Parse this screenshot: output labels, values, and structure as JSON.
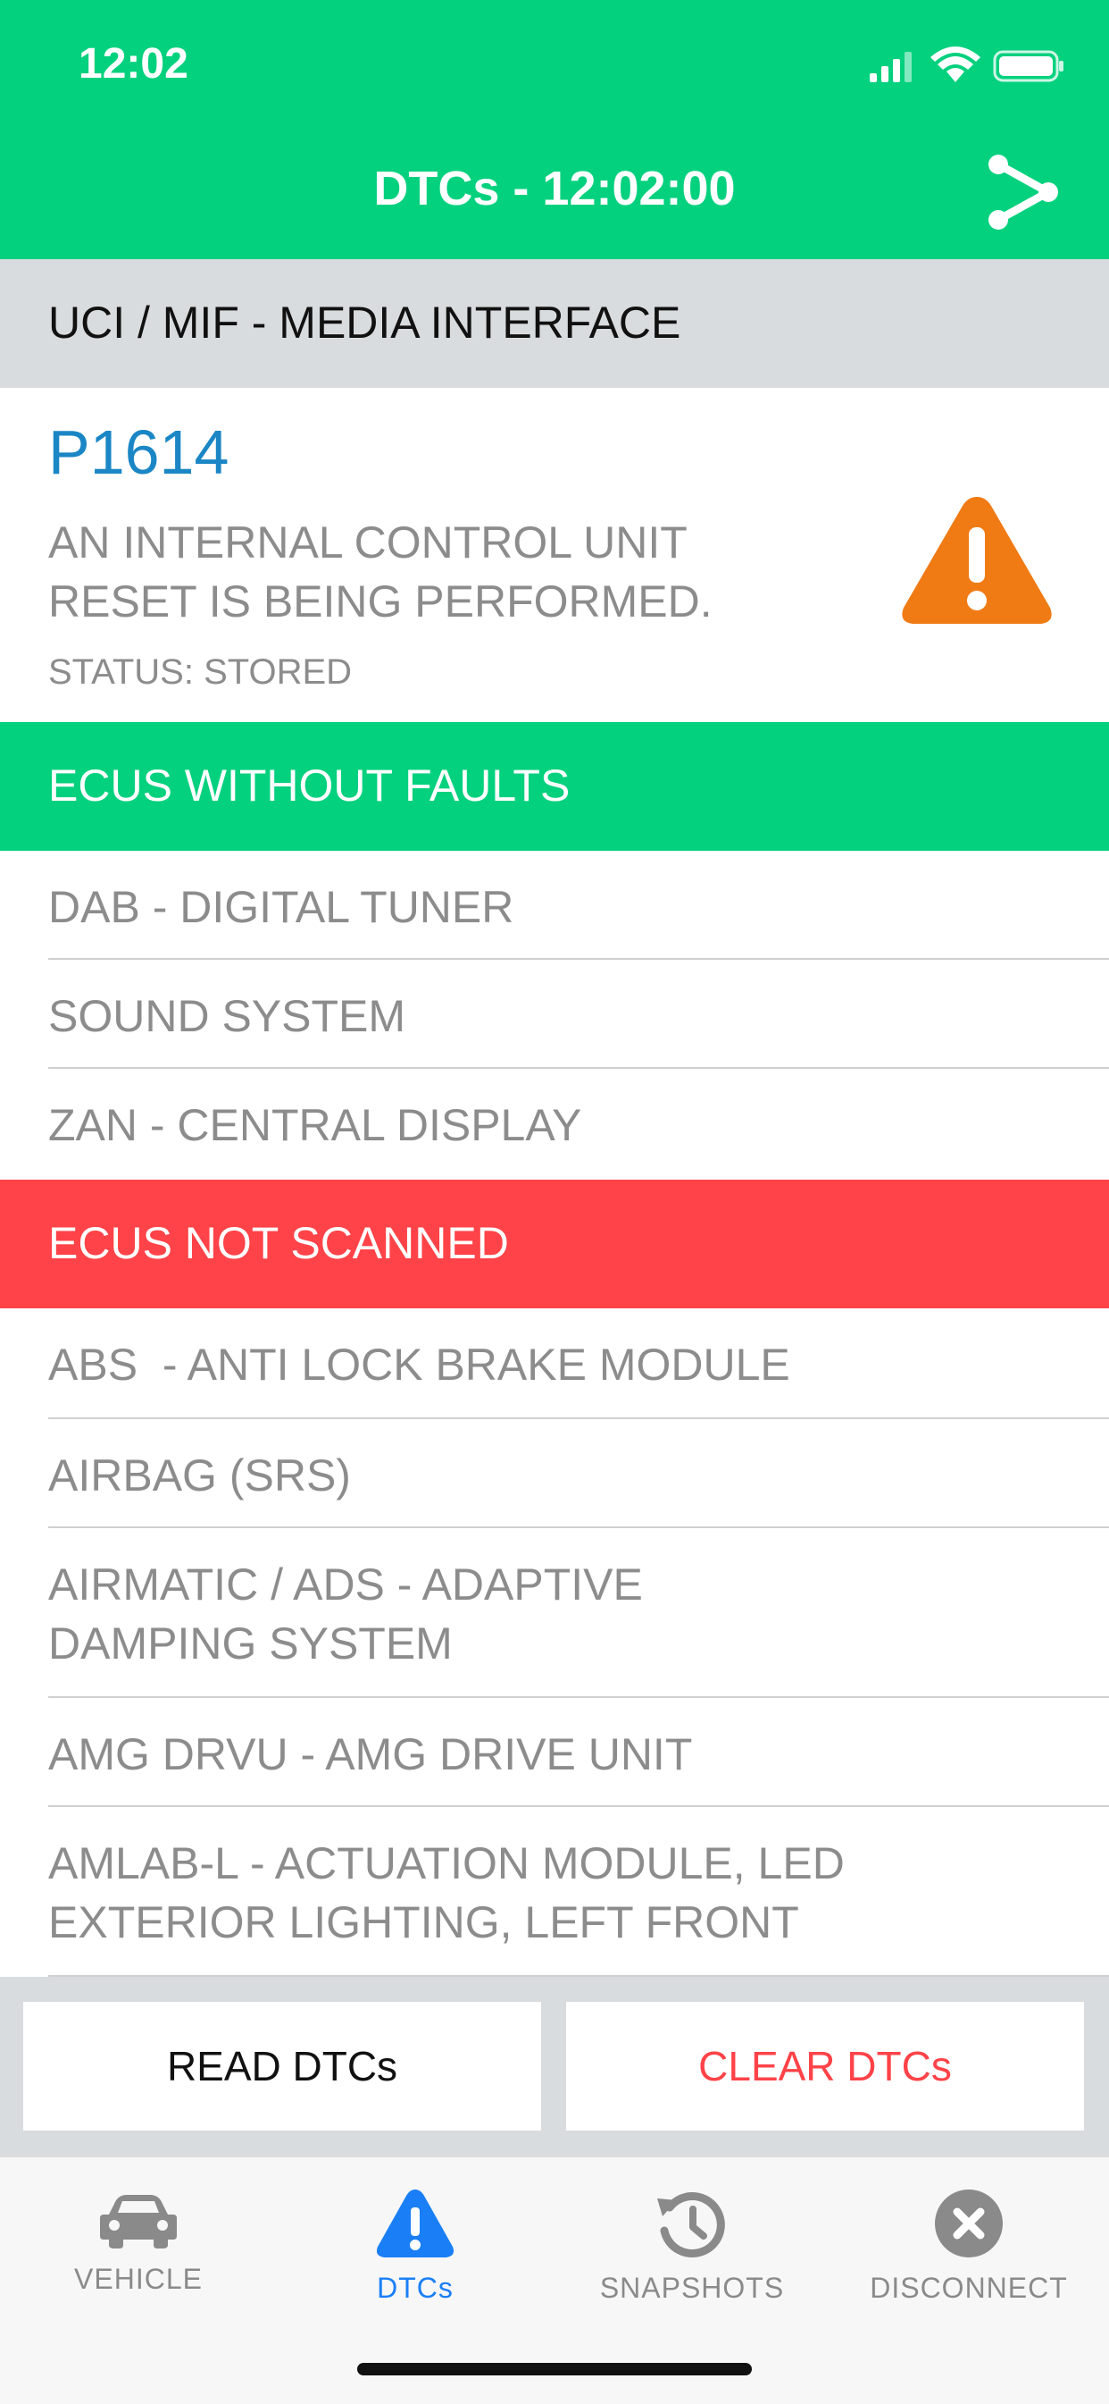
{
  "status_bar": {
    "time": "12:02"
  },
  "header": {
    "title": "DTCs - 12:02:00",
    "share_icon": "share-icon"
  },
  "ecu_section": {
    "title": "UCI / MIF - MEDIA INTERFACE"
  },
  "dtc": {
    "code": "P1614",
    "description": "AN INTERNAL CONTROL UNIT RESET IS BEING PERFORMED.",
    "status": "STATUS: STORED",
    "icon": "warning-icon"
  },
  "no_faults": {
    "title": "ECUS WITHOUT FAULTS",
    "items": [
      "DAB - DIGITAL TUNER",
      "SOUND SYSTEM",
      "ZAN - CENTRAL DISPLAY"
    ]
  },
  "not_scanned": {
    "title": "ECUS NOT SCANNED",
    "items": [
      "ABS  - ANTI LOCK BRAKE MODULE",
      "AIRBAG (SRS)",
      "AIRMATIC / ADS - ADAPTIVE\nDAMPING SYSTEM",
      "AMG DRVU - AMG DRIVE UNIT",
      "AMLAB-L - ACTUATION MODULE, LED\nEXTERIOR LIGHTING, LEFT FRONT"
    ]
  },
  "actions": {
    "read_label": "READ DTCs",
    "clear_label": "CLEAR DTCs"
  },
  "tabs": [
    {
      "label": "VEHICLE",
      "icon": "car-icon"
    },
    {
      "label": "DTCs",
      "icon": "warning-icon"
    },
    {
      "label": "SNAPSHOTS",
      "icon": "history-icon"
    },
    {
      "label": "DISCONNECT",
      "icon": "close-circle-icon"
    }
  ],
  "colors": {
    "header_green": "#04d17e",
    "alert_red": "#ff4348",
    "code_blue": "#1b86c5",
    "warning_orange": "#f07b15",
    "active_tab_blue": "#1a7ff6"
  }
}
